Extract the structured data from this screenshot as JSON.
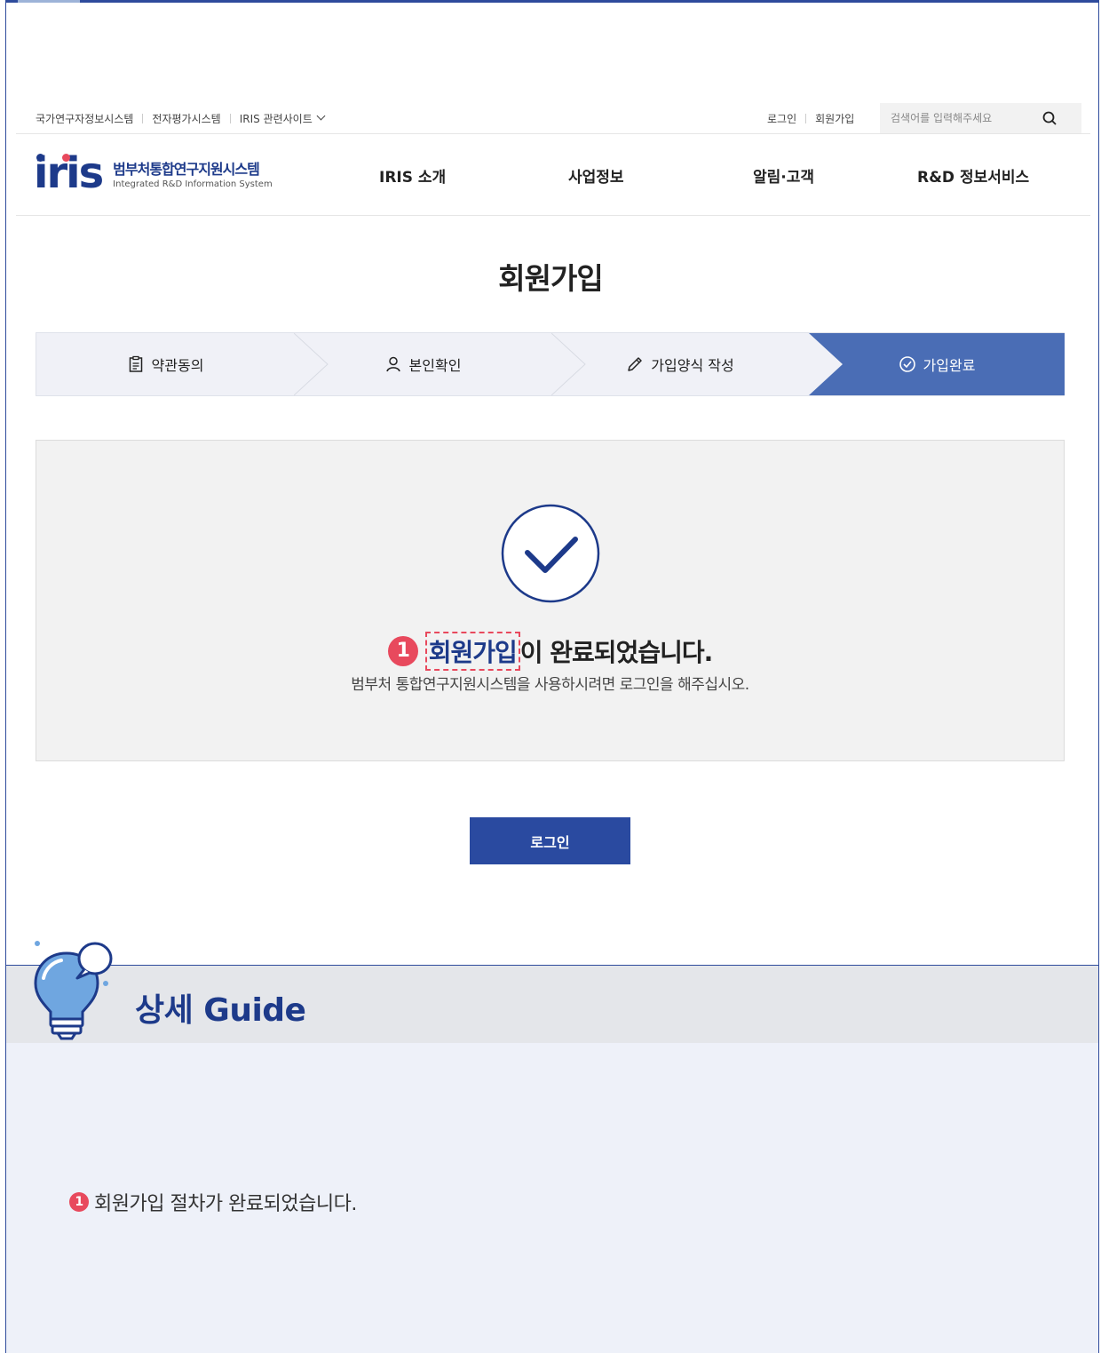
{
  "utility": {
    "links": [
      "국가연구자정보시스템",
      "전자평가시스템",
      "IRIS 관련사이트"
    ],
    "login": "로그인",
    "signup": "회원가입",
    "search_placeholder": "검색어를 입력해주세요"
  },
  "header": {
    "logo_mark": "iris",
    "logo_ko": "범부처통합연구지원시스템",
    "logo_en": "Integrated R&D Information System",
    "nav": [
      "IRIS 소개",
      "사업정보",
      "알림·고객",
      "R&D 정보서비스"
    ]
  },
  "page_title": "회원가입",
  "steps": [
    "약관동의",
    "본인확인",
    "가입양식 작성",
    "가입완료"
  ],
  "complete": {
    "badge": "1",
    "highlight": "회원가입",
    "main_rest": "이 완료되었습니다.",
    "sub": "범부처 통합연구지원시스템을 사용하시려면 로그인을 해주십시오."
  },
  "login_button": "로그인",
  "guide": {
    "title": "상세 Guide",
    "items": [
      {
        "num": "1",
        "text": "회원가입 절차가 완료되었습니다."
      }
    ]
  },
  "colors": {
    "brand": "#2a4aa0",
    "accent": "#e8495d",
    "active_step": "#4a6db5"
  }
}
